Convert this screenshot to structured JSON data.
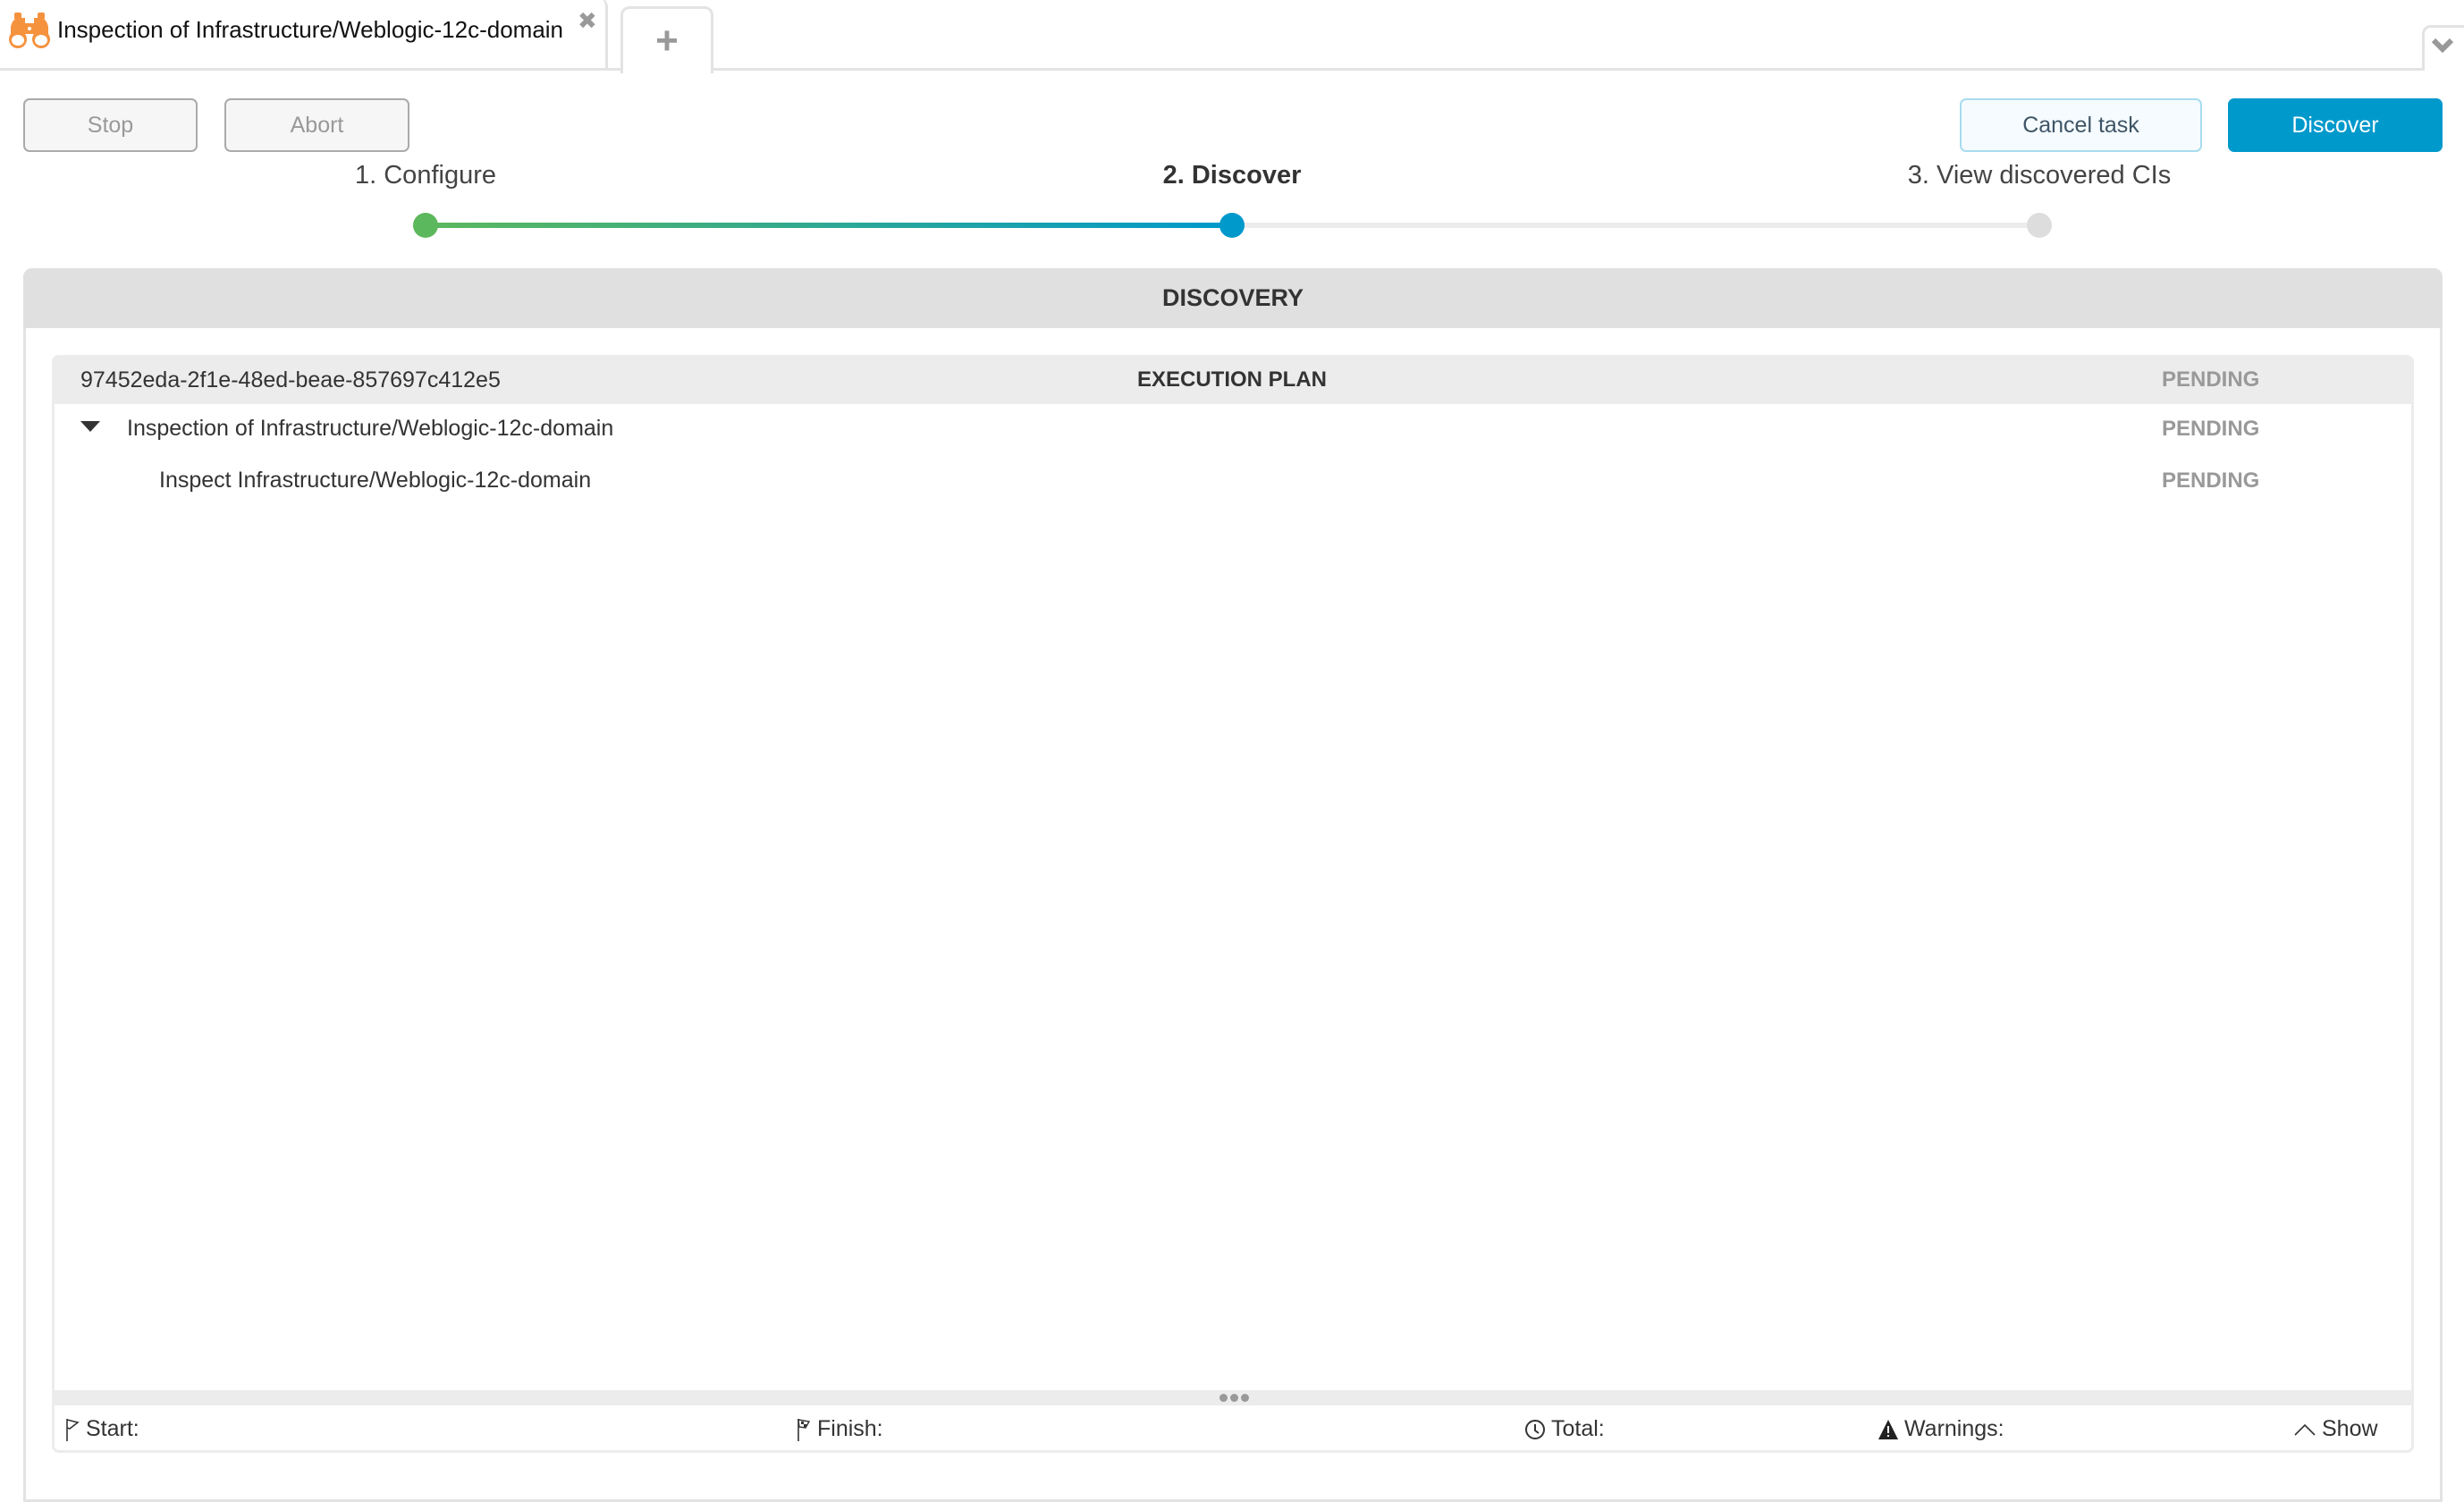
{
  "tabs": {
    "active": {
      "title": "Inspection of Infrastructure/Weblogic-12c-domain",
      "icon": "binoculars-icon"
    },
    "close_glyph": "✖",
    "add_glyph": "+",
    "menu_icon": "chevron-down-icon"
  },
  "toolbar": {
    "stop_label": "Stop",
    "abort_label": "Abort",
    "cancel_label": "Cancel task",
    "discover_label": "Discover"
  },
  "stepper": {
    "steps": [
      {
        "label": "1. Configure",
        "state": "done"
      },
      {
        "label": "2. Discover",
        "state": "active"
      },
      {
        "label": "3. View discovered CIs",
        "state": "pending"
      }
    ],
    "colors": {
      "done": "#5cb85c",
      "active": "#0099cc",
      "pending": "#dddddd"
    }
  },
  "discovery": {
    "title": "DISCOVERY",
    "plan": {
      "id": "97452eda-2f1e-48ed-beae-857697c412e5",
      "header": "EXECUTION PLAN",
      "status": "PENDING"
    },
    "rows": [
      {
        "label": "Inspection of Infrastructure/Weblogic-12c-domain",
        "status": "PENDING",
        "expanded": true
      },
      {
        "label": "Inspect Infrastructure/Weblogic-12c-domain",
        "status": "PENDING"
      }
    ]
  },
  "footer": {
    "start_label": "Start:",
    "finish_label": "Finish:",
    "total_label": "Total:",
    "warnings_label": "Warnings:",
    "show_label": "Show",
    "show_glyph": "^"
  }
}
